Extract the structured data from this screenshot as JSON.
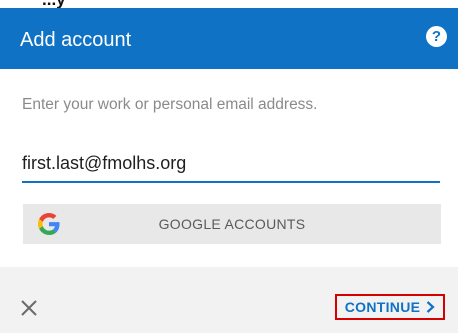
{
  "header": {
    "partial_top_text": "...y",
    "title": "Add account",
    "help_icon": "help-icon",
    "help_glyph": "?",
    "background_color": "#0F72C5"
  },
  "form": {
    "prompt": "Enter your work or personal email address.",
    "email_value": "first.last@fmolhs.org",
    "google_button_label": "GOOGLE ACCOUNTS",
    "google_icon": "google-logo-icon"
  },
  "footer": {
    "close_icon": "close-icon",
    "continue_label": "CONTINUE",
    "continue_icon": "chevron-right-icon",
    "highlight_color": "#d60000"
  }
}
